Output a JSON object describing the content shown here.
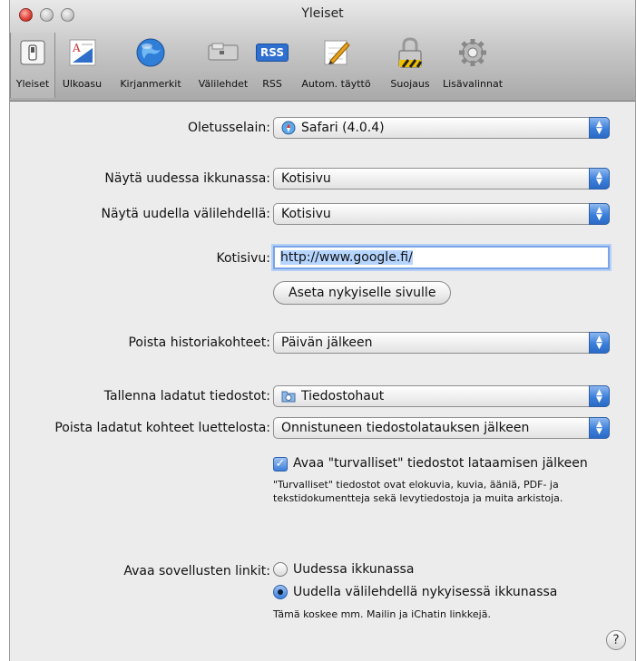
{
  "window": {
    "title": "Yleiset"
  },
  "toolbar": {
    "tabs": [
      {
        "label": "Yleiset",
        "icon": "switch-icon",
        "selected": true
      },
      {
        "label": "Ulkoasu",
        "icon": "font-icon"
      },
      {
        "label": "Kirjanmerkit",
        "icon": "globe-icon"
      },
      {
        "label": "Välilehdet",
        "icon": "tabs-icon"
      },
      {
        "label": "RSS",
        "icon": "rss-icon",
        "icon_text": "RSS"
      },
      {
        "label": "Autom. täyttö",
        "icon": "pencil-icon"
      },
      {
        "label": "Suojaus",
        "icon": "lock-icon"
      },
      {
        "label": "Lisävalinnat",
        "icon": "gear-icon"
      }
    ]
  },
  "settings": {
    "default_browser": {
      "label": "Oletusselain:",
      "value": "Safari (4.0.4)"
    },
    "new_window": {
      "label": "Näytä uudessa ikkunassa:",
      "value": "Kotisivu"
    },
    "new_tab": {
      "label": "Näytä uudella välilehdellä:",
      "value": "Kotisivu"
    },
    "homepage": {
      "label": "Kotisivu:",
      "value": "http://www.google.fi/"
    },
    "set_current_button": "Aseta nykyiselle sivulle",
    "remove_history": {
      "label": "Poista historiakohteet:",
      "value": "Päivän jälkeen"
    },
    "save_downloads": {
      "label": "Tallenna ladatut tiedostot:",
      "value": "Tiedostohaut"
    },
    "remove_downloads": {
      "label": "Poista ladatut kohteet luettelosta:",
      "value": "Onnistuneen tiedostolatauksen jälkeen"
    },
    "open_safe": {
      "label": "Avaa \"turvalliset\" tiedostot lataamisen jälkeen",
      "checked": true
    },
    "open_safe_note": "\"Turvalliset\" tiedostot ovat elokuvia, kuvia, ääniä, PDF- ja tekstidokumentteja sekä levytiedostoja ja muita arkistoja.",
    "app_links": {
      "label": "Avaa sovellusten linkit:",
      "options": [
        "Uudessa ikkunassa",
        "Uudella välilehdellä nykyisessä ikkunassa"
      ],
      "selected_index": 1
    },
    "app_links_note": "Tämä koskee mm. Mailin ja iChatin linkkejä.",
    "help": "?"
  },
  "colors": {
    "accent": "#3b7fdb",
    "selection": "#b5d5ff"
  }
}
